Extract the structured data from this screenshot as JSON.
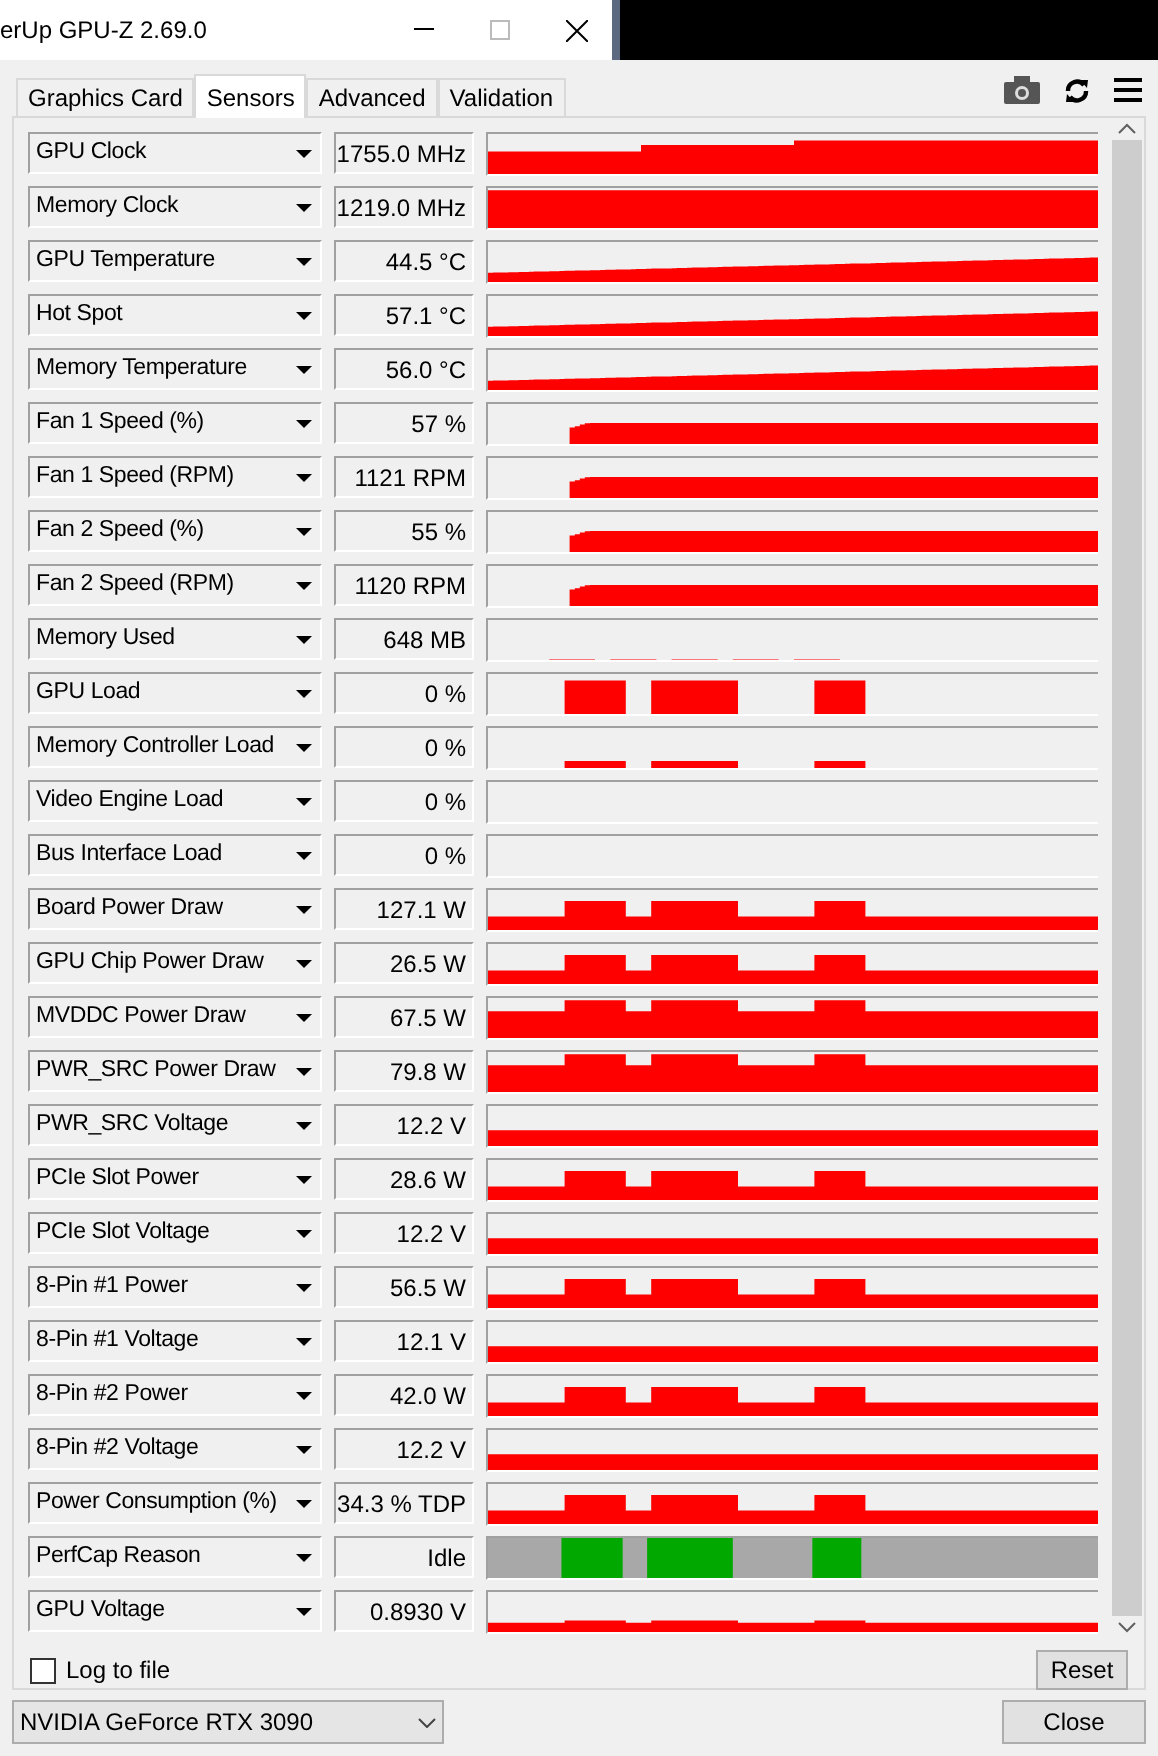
{
  "window": {
    "title": "erUp GPU-Z 2.69.0"
  },
  "tabs": [
    {
      "label": "Graphics Card",
      "selected": false
    },
    {
      "label": "Sensors",
      "selected": true
    },
    {
      "label": "Advanced",
      "selected": false
    },
    {
      "label": "Validation",
      "selected": false
    }
  ],
  "sensors": [
    {
      "name": "GPU Clock",
      "value": "1755.0 MHz",
      "kind": "high"
    },
    {
      "name": "Memory Clock",
      "value": "1219.0 MHz",
      "kind": "full"
    },
    {
      "name": "GPU Temperature",
      "value": "44.5 °C",
      "kind": "rising"
    },
    {
      "name": "Hot Spot",
      "value": "57.1 °C",
      "kind": "rising"
    },
    {
      "name": "Memory Temperature",
      "value": "56.0 °C",
      "kind": "rising"
    },
    {
      "name": "Fan 1 Speed (%)",
      "value": "57 %",
      "kind": "fan"
    },
    {
      "name": "Fan 1 Speed (RPM)",
      "value": "1121 RPM",
      "kind": "fan"
    },
    {
      "name": "Fan 2 Speed (%)",
      "value": "55 %",
      "kind": "fan"
    },
    {
      "name": "Fan 2 Speed (RPM)",
      "value": "1120 RPM",
      "kind": "fan"
    },
    {
      "name": "Memory Used",
      "value": "648 MB",
      "kind": "line"
    },
    {
      "name": "GPU Load",
      "value": "0 %",
      "kind": "spikes"
    },
    {
      "name": "Memory Controller Load",
      "value": "0 %",
      "kind": "spikes_low"
    },
    {
      "name": "Video Engine Load",
      "value": "0 %",
      "kind": "empty"
    },
    {
      "name": "Bus Interface Load",
      "value": "0 %",
      "kind": "empty"
    },
    {
      "name": "Board Power Draw",
      "value": "127.1 W",
      "kind": "spikes_base"
    },
    {
      "name": "GPU Chip Power Draw",
      "value": "26.5 W",
      "kind": "spikes_base"
    },
    {
      "name": "MVDDC Power Draw",
      "value": "67.5 W",
      "kind": "bumps"
    },
    {
      "name": "PWR_SRC Power Draw",
      "value": "79.8 W",
      "kind": "bumps"
    },
    {
      "name": "PWR_SRC Voltage",
      "value": "12.2 V",
      "kind": "band"
    },
    {
      "name": "PCIe Slot Power",
      "value": "28.6 W",
      "kind": "spikes_base"
    },
    {
      "name": "PCIe Slot Voltage",
      "value": "12.2 V",
      "kind": "band"
    },
    {
      "name": "8-Pin #1 Power",
      "value": "56.5 W",
      "kind": "spikes_base"
    },
    {
      "name": "8-Pin #1 Voltage",
      "value": "12.1 V",
      "kind": "band"
    },
    {
      "name": "8-Pin #2 Power",
      "value": "42.0 W",
      "kind": "spikes_base"
    },
    {
      "name": "8-Pin #2 Voltage",
      "value": "12.2 V",
      "kind": "band"
    },
    {
      "name": "Power Consumption (%)",
      "value": "34.3 % TDP",
      "kind": "spikes_base"
    },
    {
      "name": "PerfCap Reason",
      "value": "Idle",
      "kind": "perfcap"
    },
    {
      "name": "GPU Voltage",
      "value": "0.8930 V",
      "kind": "thin"
    }
  ],
  "log_to_file": {
    "label": "Log to file",
    "checked": false
  },
  "reset_button": "Reset",
  "gpu_select": {
    "value": "NVIDIA GeForce RTX 3090"
  },
  "close_button": "Close"
}
